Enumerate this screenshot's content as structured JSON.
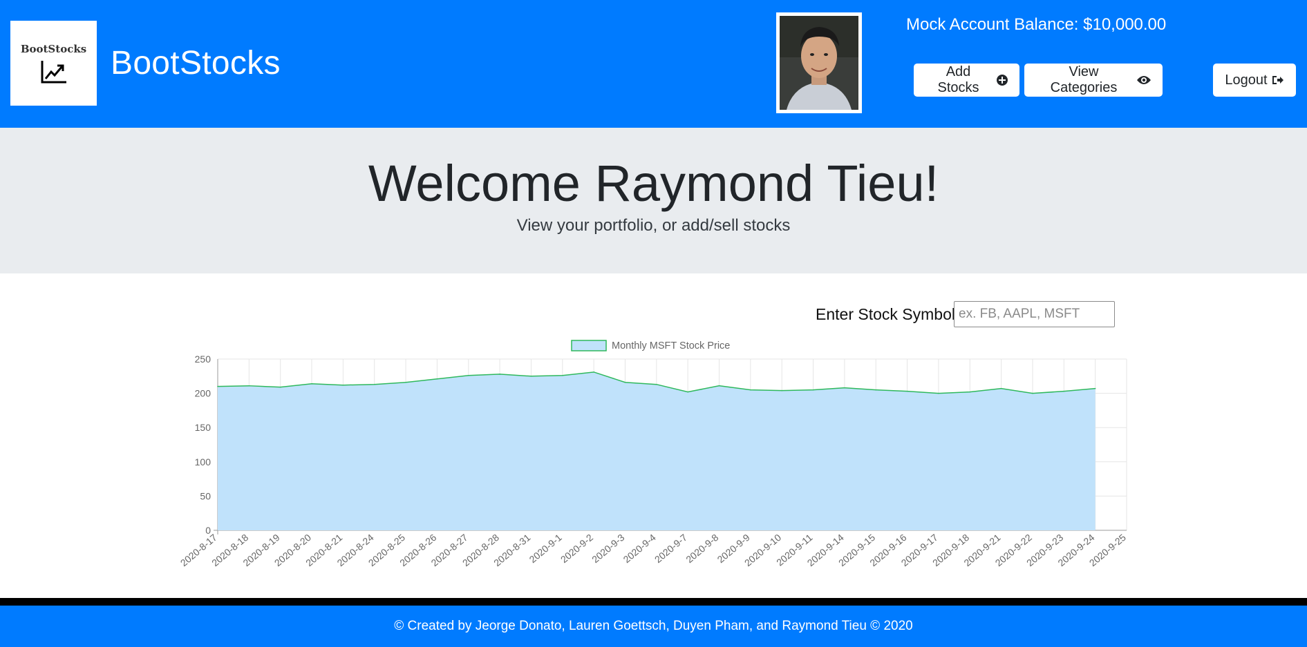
{
  "header": {
    "logo_text": "BootStocks",
    "brand": "BootStocks",
    "balance": "Mock Account Balance: $10,000.00",
    "buttons": {
      "add": "Add Stocks",
      "view": "View Categories",
      "logout": "Logout"
    },
    "icons": {
      "add": "plus-circle-icon",
      "view": "eye-icon",
      "logout": "sign-out-icon"
    },
    "colors": {
      "primary": "#007bff"
    }
  },
  "jumbotron": {
    "title": "Welcome Raymond Tieu!",
    "subtitle": "View your portfolio, or add/sell stocks"
  },
  "search": {
    "label": "Enter Stock Symbol:",
    "placeholder": "ex. FB, AAPL, MSFT",
    "value": ""
  },
  "chart_data": {
    "type": "area",
    "categories": [
      "2020-8-17",
      "2020-8-18",
      "2020-8-19",
      "2020-8-20",
      "2020-8-21",
      "2020-8-24",
      "2020-8-25",
      "2020-8-26",
      "2020-8-27",
      "2020-8-28",
      "2020-8-31",
      "2020-9-1",
      "2020-9-2",
      "2020-9-3",
      "2020-9-4",
      "2020-9-7",
      "2020-9-8",
      "2020-9-9",
      "2020-9-10",
      "2020-9-11",
      "2020-9-14",
      "2020-9-15",
      "2020-9-16",
      "2020-9-17",
      "2020-9-18",
      "2020-9-21",
      "2020-9-22",
      "2020-9-23",
      "2020-9-24",
      "2020-9-25"
    ],
    "series": [
      {
        "name": "Monthly MSFT Stock Price",
        "values": [
          210,
          211,
          209,
          214,
          212,
          213,
          216,
          221,
          226,
          228,
          225,
          226,
          231,
          216,
          213,
          202,
          211,
          205,
          204,
          205,
          208,
          205,
          203,
          200,
          202,
          207,
          200,
          203,
          207,
          null
        ],
        "line_color": "#2eb85c",
        "fill_color": "#c0e2fb"
      }
    ],
    "ylim": [
      0,
      250
    ],
    "yticks": [
      0,
      50,
      100,
      150,
      200,
      250
    ],
    "grid": true,
    "legend": "top-center"
  },
  "footer": {
    "text": "© Created by Jeorge Donato, Lauren Goettsch, Duyen Pham, and Raymond Tieu © 2020"
  }
}
